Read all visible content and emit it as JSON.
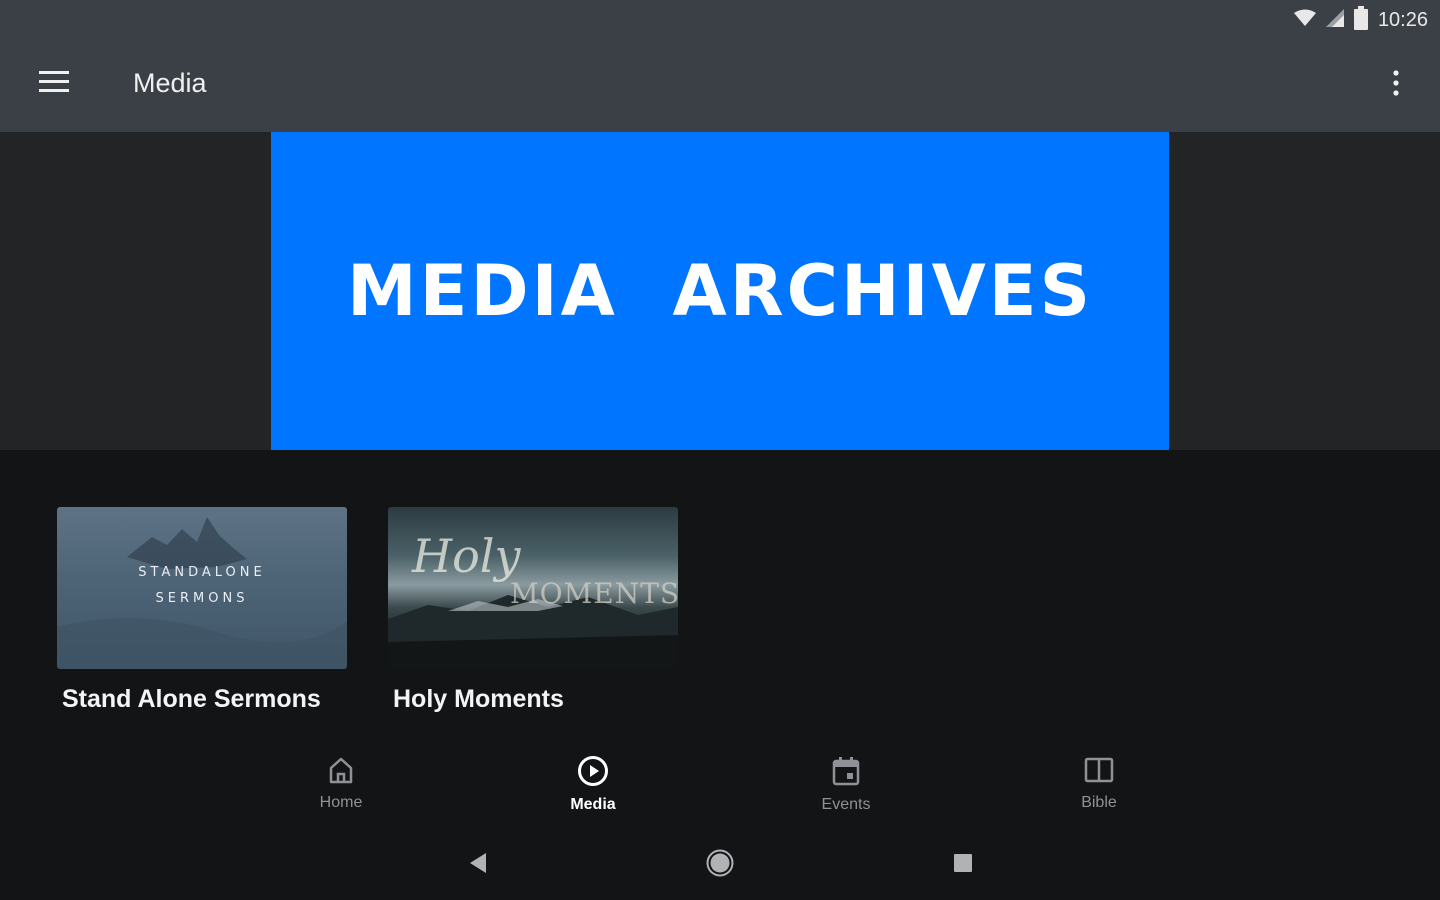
{
  "status_bar": {
    "time": "10:26",
    "icons": [
      "wifi-icon",
      "signal-icon",
      "battery-icon"
    ]
  },
  "app_bar": {
    "title": "Media",
    "menu_icon": "hamburger-menu-icon",
    "overflow_icon": "more-vert-icon"
  },
  "hero": {
    "title": "MEDIA  ARCHIVES",
    "background_color": "#0075ff"
  },
  "series": [
    {
      "title": "Stand Alone Sermons",
      "thumbnail_text": [
        "STANDALONE",
        "SERMONS"
      ]
    },
    {
      "title": "Holy Moments",
      "thumbnail_text": [
        "Holy",
        "MOMENTS"
      ]
    }
  ],
  "bottom_nav": {
    "items": [
      {
        "label": "Home",
        "icon": "home-icon",
        "active": false
      },
      {
        "label": "Media",
        "icon": "play-circle-icon",
        "active": true
      },
      {
        "label": "Events",
        "icon": "calendar-icon",
        "active": false
      },
      {
        "label": "Bible",
        "icon": "book-icon",
        "active": false
      }
    ]
  },
  "system_nav": {
    "icons": [
      "back-icon",
      "home-circle-icon",
      "recents-icon"
    ]
  },
  "colors": {
    "app_bar": "#3b4046",
    "background": "#131416",
    "active_nav": "#ffffff",
    "inactive_nav": "#8e9296"
  }
}
